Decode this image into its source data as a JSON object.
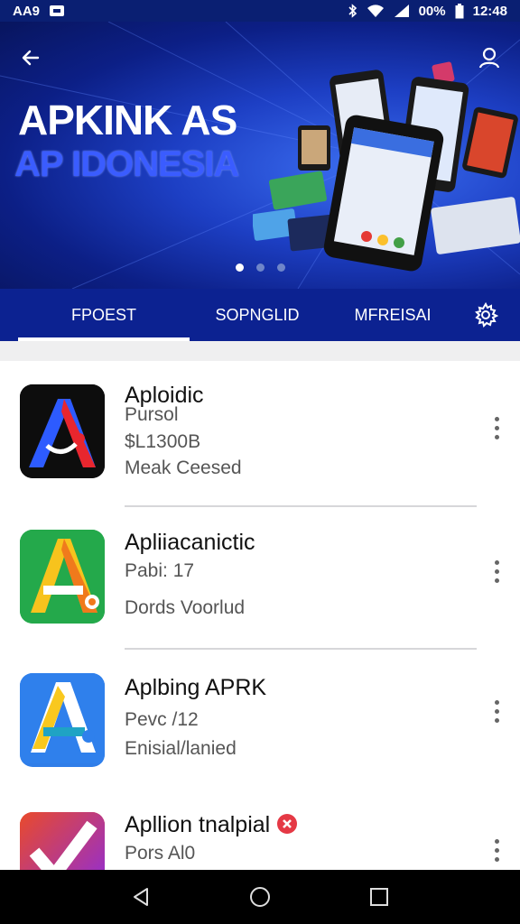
{
  "status_bar": {
    "carrier": "AA9",
    "battery": "00%",
    "time": "12:48",
    "icons": [
      "notification-icon",
      "bluetooth-icon",
      "wifi-icon",
      "signal-icon",
      "battery-icon"
    ]
  },
  "hero": {
    "title": "APKINK AS",
    "subtitle": "AP IDONESIA",
    "slides": 3,
    "active_slide": 0,
    "colors": {
      "title": "#ffffff",
      "subtitle": "#3a5cff",
      "background": "#1d3fc4"
    }
  },
  "tabs": [
    {
      "label": "FPOEST",
      "active": true
    },
    {
      "label": "SOPNGLID",
      "active": false
    },
    {
      "label": "MFREISAI",
      "active": false
    }
  ],
  "apps": [
    {
      "name": "Aploidic",
      "line1": "Pursol",
      "line2": "$L1300B",
      "line3": "Meak Ceesed",
      "icon": "red-blue-a-icon"
    },
    {
      "name": "Apliiacanictic",
      "line1": "Pabi: 17",
      "line2": "Dords Voorlud",
      "icon": "green-orange-a-icon"
    },
    {
      "name": "Aplbing APRK",
      "line1": "Pevc /12",
      "line2": "Enisial/lanied",
      "icon": "blue-yellow-a-icon"
    },
    {
      "name": "Apllion tnalpial",
      "line1": "Pors Al0",
      "icon": "red-check-icon"
    }
  ],
  "nav": [
    "back-triangle-icon",
    "home-circle-icon",
    "recents-square-icon"
  ]
}
